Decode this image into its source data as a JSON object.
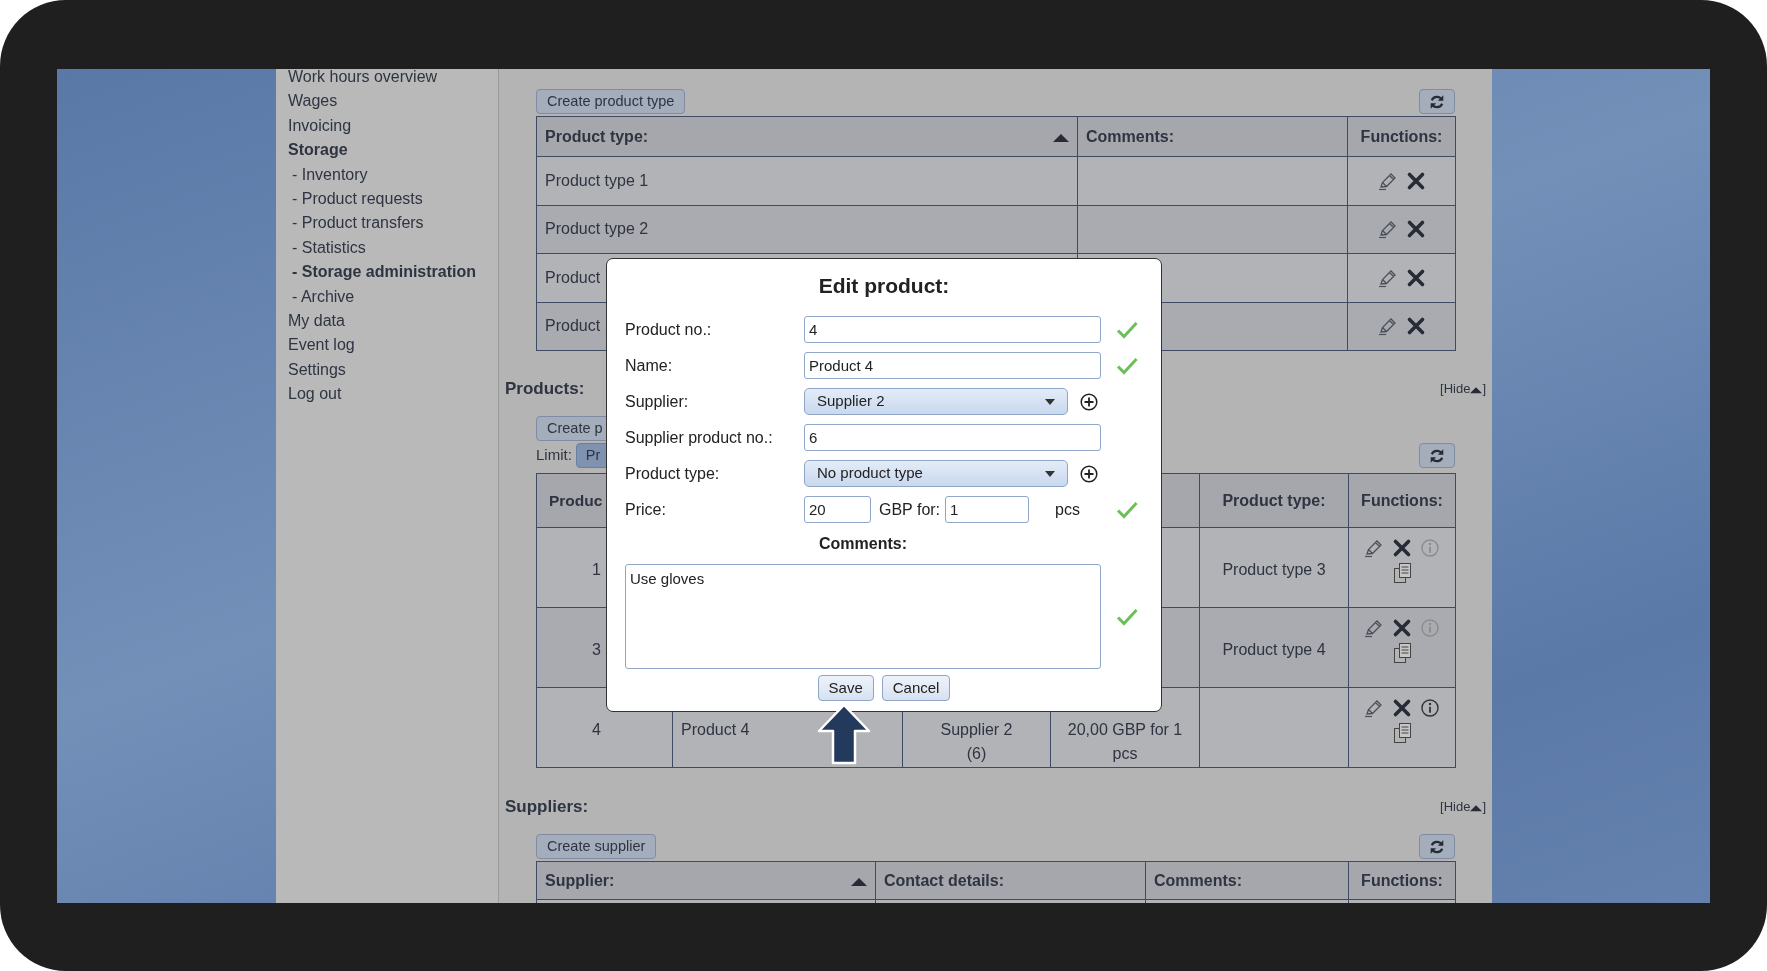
{
  "sidebar": {
    "items": [
      {
        "label": "Work hours overview",
        "selected": false
      },
      {
        "label": "Wages",
        "selected": false
      },
      {
        "label": "Invoicing",
        "selected": false
      },
      {
        "label": "Storage",
        "selected": true,
        "children": [
          {
            "label": "- Inventory",
            "selected": false
          },
          {
            "label": "- Product requests",
            "selected": false
          },
          {
            "label": "- Product transfers",
            "selected": false
          },
          {
            "label": "- Statistics",
            "selected": false
          },
          {
            "label": "- Storage administration",
            "selected": true
          },
          {
            "label": "- Archive",
            "selected": false
          }
        ]
      },
      {
        "label": "My data",
        "selected": false
      },
      {
        "label": "Event log",
        "selected": false
      },
      {
        "label": "Settings",
        "selected": false
      },
      {
        "label": "Log out",
        "selected": false
      }
    ]
  },
  "product_types": {
    "create_button": "Create product type",
    "columns": [
      {
        "label": "Product type:",
        "sorted": true
      },
      {
        "label": "Comments:"
      },
      {
        "label": "Functions:"
      }
    ],
    "rows": [
      {
        "product_type": "Product type 1"
      },
      {
        "product_type": "Product type 2"
      },
      {
        "product_type": "Product"
      },
      {
        "product_type": "Product"
      }
    ]
  },
  "products": {
    "title": "Products:",
    "hide_link": "[Hide",
    "hide_close": "]",
    "create_button": "Create p",
    "limit_label": "Limit:",
    "limit_button": "Pr",
    "columns": [
      {
        "label": "Produc"
      },
      {},
      {},
      {},
      {
        "label": "Product type:"
      },
      {
        "label": "Functions:"
      }
    ],
    "rows": [
      {
        "no": "1",
        "product_type": "Product type 3",
        "info_enabled": false
      },
      {
        "no": "3",
        "product_type": "Product type 4",
        "info_enabled": false
      },
      {
        "no": "4",
        "name": "Product 4",
        "supplier": "Supplier 2\n(6)",
        "price": "20,00 GBP for 1 pcs",
        "info_enabled": true
      }
    ]
  },
  "suppliers": {
    "title": "Suppliers:",
    "hide_link": "[Hide",
    "hide_close": "]",
    "create_button": "Create supplier",
    "columns": [
      {
        "label": "Supplier:",
        "sorted": true
      },
      {
        "label": "Contact details:"
      },
      {
        "label": "Comments:"
      },
      {
        "label": "Functions:"
      }
    ]
  },
  "dialog": {
    "title": "Edit product:",
    "fields": [
      {
        "kind": "text",
        "label": "Product no.:",
        "value": "4",
        "valid": true
      },
      {
        "kind": "text",
        "label": "Name:",
        "value": "Product 4",
        "valid": true
      },
      {
        "kind": "select",
        "label": "Supplier:",
        "value": "Supplier 2",
        "add": true
      },
      {
        "kind": "text",
        "label": "Supplier product no.:",
        "value": "6"
      },
      {
        "kind": "select",
        "label": "Product type:",
        "value": "No product type",
        "add": true
      },
      {
        "kind": "price",
        "label": "Price:",
        "value": "20",
        "unit_label": "GBP for:",
        "quantity": "1",
        "unit": "pcs",
        "valid": true
      }
    ],
    "comments": {
      "label": "Comments:",
      "value": "Use gloves",
      "valid": true
    },
    "buttons": [
      {
        "label": "Save"
      },
      {
        "label": "Cancel"
      }
    ]
  }
}
